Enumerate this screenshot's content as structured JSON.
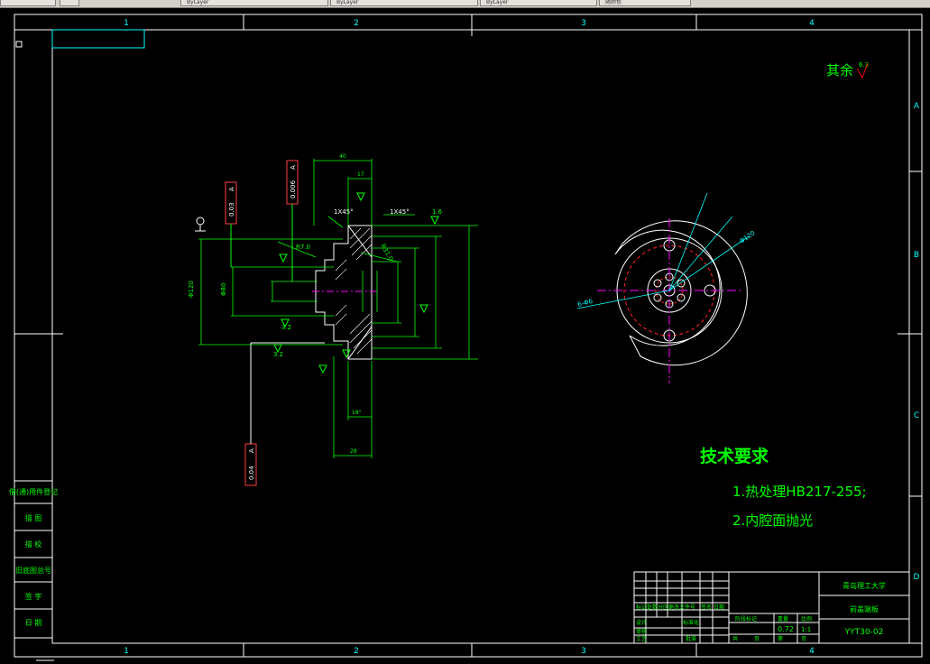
{
  "toolbar": {
    "items": [
      "ByLayer",
      "ByLayer",
      "ByLayer",
      "随颜色"
    ]
  },
  "frame": {
    "col_labels": [
      "1",
      "2",
      "3",
      "4"
    ],
    "row_labels": [
      "A",
      "B",
      "C",
      "D"
    ]
  },
  "surface_note": {
    "text": "其余",
    "value": "6.3"
  },
  "tolerances": {
    "circular_runout": "0.03",
    "total_runout": "0.006",
    "perpendicularity": "0.04",
    "datum": "A"
  },
  "dimensions": {
    "width_40": "40",
    "width_17": "17",
    "width_28": "28",
    "chamfer_left": "1X45°",
    "chamfer_right": "1X45°",
    "radius_7": "R7.0",
    "radius_31": "R31.0",
    "roughness_32": "3.2",
    "roughness_16": "1.6",
    "hole_pattern": "6-Φ6",
    "dia_80": "Φ80",
    "dia_120": "Φ120",
    "angle_18": "18°"
  },
  "tech_requirements": {
    "title": "技术要求",
    "line1": "1.热处理HB217-255;",
    "line2": "2.内腔面抛光"
  },
  "title_block": {
    "university": "青岛理工大学",
    "part_name": "前盖端板",
    "drawing_no": "YYT30-02",
    "weight": "0.72",
    "scale": "1:1",
    "labels": [
      "标记",
      "处数",
      "分区",
      "更改文件号",
      "签名",
      "日期",
      "设计",
      "标准化",
      "审核",
      "工艺",
      "批准",
      "阶段标记",
      "重量",
      "比例",
      "共",
      "页",
      "第",
      "页"
    ]
  },
  "side_table": {
    "rows": [
      "借(通)用件登记",
      "描  图",
      "描  校",
      "旧底图总号",
      "签  字",
      "日  期"
    ]
  }
}
